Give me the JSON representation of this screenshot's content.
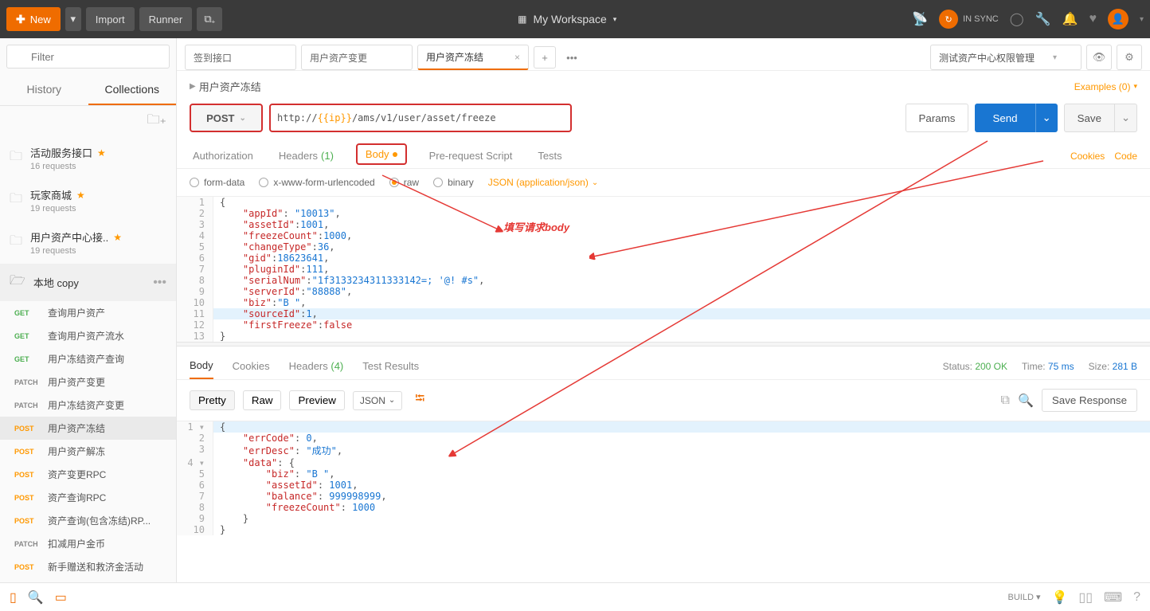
{
  "topbar": {
    "new": "New",
    "import": "Import",
    "runner": "Runner",
    "workspace": "My Workspace",
    "sync": "IN SYNC"
  },
  "sidebar": {
    "filter_placeholder": "Filter",
    "tab_history": "History",
    "tab_collections": "Collections",
    "collections": [
      {
        "name": "活动服务接口",
        "starred": true,
        "meta": "16 requests"
      },
      {
        "name": "玩家商城",
        "starred": true,
        "meta": "19 requests"
      },
      {
        "name": "用户资产中心接..",
        "starred": true,
        "meta": "19 requests"
      }
    ],
    "open_collection": "本地 copy",
    "requests": [
      {
        "method": "GET",
        "name": "查询用户资产"
      },
      {
        "method": "GET",
        "name": "查询用户资产流水"
      },
      {
        "method": "GET",
        "name": "用户冻结资产查询"
      },
      {
        "method": "PATCH",
        "name": "用户资产变更"
      },
      {
        "method": "PATCH",
        "name": "用户冻结资产变更"
      },
      {
        "method": "POST",
        "name": "用户资产冻结",
        "active": true
      },
      {
        "method": "POST",
        "name": "用户资产解冻"
      },
      {
        "method": "POST",
        "name": "资产变更RPC"
      },
      {
        "method": "POST",
        "name": "资产查询RPC"
      },
      {
        "method": "POST",
        "name": "资产查询(包含冻结)RP..."
      },
      {
        "method": "PATCH",
        "name": "扣减用户金币"
      },
      {
        "method": "POST",
        "name": "新手赠送和救济金活动"
      }
    ]
  },
  "tabs": {
    "items": [
      {
        "label": "签到接口"
      },
      {
        "label": "用户资产变更"
      },
      {
        "label": "用户资产冻结",
        "closeable": true,
        "active": true
      }
    ]
  },
  "env": {
    "name": "测试资产中心权限管理"
  },
  "crumb": "用户资产冻结",
  "examples_label": "Examples (0)",
  "request": {
    "method": "POST",
    "url_prefix": "http://",
    "url_var": "{{ip}}",
    "url_path": "/ams/v1/user/asset/freeze",
    "params": "Params",
    "send": "Send",
    "save": "Save",
    "subtabs": {
      "authorization": "Authorization",
      "headers": "Headers",
      "headers_count": "(1)",
      "body": "Body",
      "prerequest": "Pre-request Script",
      "tests": "Tests"
    },
    "cookies_link": "Cookies",
    "code_link": "Code",
    "body_types": {
      "formdata": "form-data",
      "xwww": "x-www-form-urlencoded",
      "raw": "raw",
      "binary": "binary"
    },
    "json_type": "JSON (application/json)",
    "body_lines": [
      [
        [
          "p",
          "{"
        ]
      ],
      [
        [
          "p",
          "    "
        ],
        [
          "k",
          "\"appId\""
        ],
        [
          "p",
          ": "
        ],
        [
          "s",
          "\"10013\""
        ],
        [
          "p",
          ","
        ]
      ],
      [
        [
          "p",
          "    "
        ],
        [
          "k",
          "\"assetId\""
        ],
        [
          "p",
          ":"
        ],
        [
          "n",
          "1001"
        ],
        [
          "p",
          ","
        ]
      ],
      [
        [
          "p",
          "    "
        ],
        [
          "k",
          "\"freezeCount\""
        ],
        [
          "p",
          ":"
        ],
        [
          "n",
          "1000"
        ],
        [
          "p",
          ","
        ]
      ],
      [
        [
          "p",
          "    "
        ],
        [
          "k",
          "\"changeType\""
        ],
        [
          "p",
          ":"
        ],
        [
          "n",
          "36"
        ],
        [
          "p",
          ","
        ]
      ],
      [
        [
          "p",
          "    "
        ],
        [
          "k",
          "\"gid\""
        ],
        [
          "p",
          ":"
        ],
        [
          "n",
          "18623641"
        ],
        [
          "p",
          ","
        ]
      ],
      [
        [
          "p",
          "    "
        ],
        [
          "k",
          "\"pluginId\""
        ],
        [
          "p",
          ":"
        ],
        [
          "n",
          "111"
        ],
        [
          "p",
          ","
        ]
      ],
      [
        [
          "p",
          "    "
        ],
        [
          "k",
          "\"serialNum\""
        ],
        [
          "p",
          ":"
        ],
        [
          "s",
          "\"1f3133234311333142=; '@! #s\""
        ],
        [
          "p",
          ","
        ]
      ],
      [
        [
          "p",
          "    "
        ],
        [
          "k",
          "\"serverId\""
        ],
        [
          "p",
          ":"
        ],
        [
          "s",
          "\"88888\""
        ],
        [
          "p",
          ","
        ]
      ],
      [
        [
          "p",
          "    "
        ],
        [
          "k",
          "\"biz\""
        ],
        [
          "p",
          ":"
        ],
        [
          "s",
          "\"B \""
        ],
        [
          "p",
          ","
        ]
      ],
      [
        [
          "p",
          "    "
        ],
        [
          "k",
          "\"sourceId\""
        ],
        [
          "p",
          ":"
        ],
        [
          "n",
          "1"
        ],
        [
          "p",
          ","
        ]
      ],
      [
        [
          "p",
          "    "
        ],
        [
          "k",
          "\"firstFreeze\""
        ],
        [
          "p",
          ":"
        ],
        [
          "bool",
          "false"
        ]
      ],
      [
        [
          "p",
          "}"
        ]
      ]
    ],
    "hl_line": 11
  },
  "annotations": {
    "body_note": "填写请求body"
  },
  "response": {
    "tabs": {
      "body": "Body",
      "cookies": "Cookies",
      "headers": "Headers",
      "headers_count": "(4)",
      "tests": "Test Results"
    },
    "status_label": "Status:",
    "status": "200 OK",
    "time_label": "Time:",
    "time": "75 ms",
    "size_label": "Size:",
    "size": "281 B",
    "fmt": {
      "pretty": "Pretty",
      "raw": "Raw",
      "preview": "Preview",
      "json": "JSON"
    },
    "save_response": "Save Response",
    "body_lines": [
      [
        [
          "p",
          "{"
        ]
      ],
      [
        [
          "p",
          "    "
        ],
        [
          "k",
          "\"errCode\""
        ],
        [
          "p",
          ": "
        ],
        [
          "n",
          "0"
        ],
        [
          "p",
          ","
        ]
      ],
      [
        [
          "p",
          "    "
        ],
        [
          "k",
          "\"errDesc\""
        ],
        [
          "p",
          ": "
        ],
        [
          "s",
          "\"成功\""
        ],
        [
          "p",
          ","
        ]
      ],
      [
        [
          "p",
          "    "
        ],
        [
          "k",
          "\"data\""
        ],
        [
          "p",
          ": {"
        ]
      ],
      [
        [
          "p",
          "        "
        ],
        [
          "k",
          "\"biz\""
        ],
        [
          "p",
          ": "
        ],
        [
          "s",
          "\"B \""
        ],
        [
          "p",
          ","
        ]
      ],
      [
        [
          "p",
          "        "
        ],
        [
          "k",
          "\"assetId\""
        ],
        [
          "p",
          ": "
        ],
        [
          "n",
          "1001"
        ],
        [
          "p",
          ","
        ]
      ],
      [
        [
          "p",
          "        "
        ],
        [
          "k",
          "\"balance\""
        ],
        [
          "p",
          ": "
        ],
        [
          "n",
          "999998999"
        ],
        [
          "p",
          ","
        ]
      ],
      [
        [
          "p",
          "        "
        ],
        [
          "k",
          "\"freezeCount\""
        ],
        [
          "p",
          ": "
        ],
        [
          "n",
          "1000"
        ]
      ],
      [
        [
          "p",
          "    }"
        ]
      ],
      [
        [
          "p",
          "}"
        ]
      ]
    ],
    "fold_lines": [
      1,
      4
    ]
  },
  "bottombar": {
    "build": "BUILD"
  }
}
